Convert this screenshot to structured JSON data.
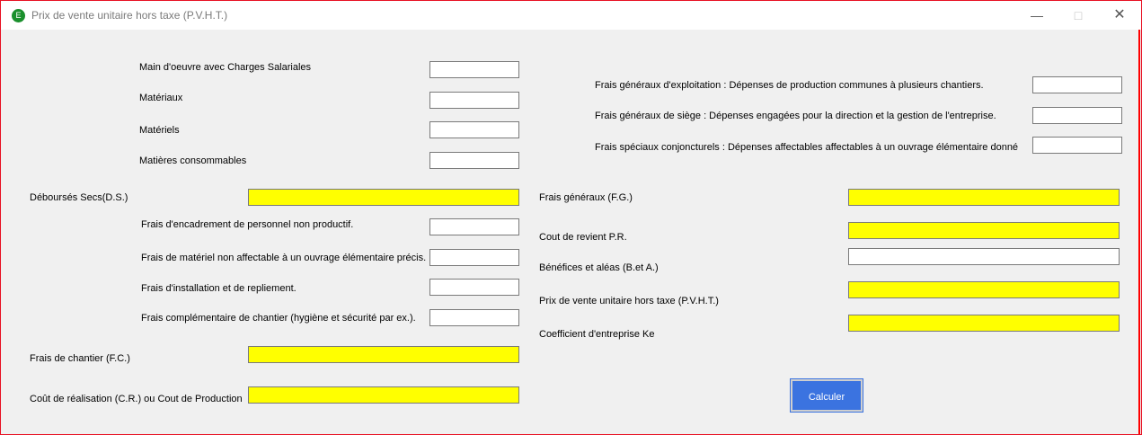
{
  "window": {
    "title": "Prix de vente unitaire hors taxe (P.V.H.T.)",
    "icon_letter": "E",
    "icon": "app-icon"
  },
  "left": {
    "main_oeuvre": "Main d'oeuvre avec Charges Salariales",
    "materiaux": "Matériaux",
    "materiels": "Matériels",
    "matieres": "Matières consommables",
    "debourses": "Déboursés Secs(D.S.)",
    "frais_encadrement": "Frais d'encadrement de personnel non productif.",
    "frais_materiel": "Frais de matériel non affectable à un ouvrage élémentaire précis.",
    "frais_installation": "Frais d'installation et de repliement.",
    "frais_complementaire": "Frais complémentaire de chantier (hygiène et  sécurité par ex.).",
    "frais_chantier": "Frais de chantier (F.C.)",
    "cout_realisation": "Coût de réalisation (C.R.) ou Cout de Production"
  },
  "right": {
    "fg_exploitation": "Frais généraux d'exploitation : Dépenses de production communes à plusieurs chantiers.",
    "fg_siege": "Frais généraux de siège : Dépenses engagées  pour la direction et la gestion de l'entreprise.",
    "fs_conjoncturels": "Frais spéciaux conjoncturels  : Dépenses affectables affectables à un ouvrage élémentaire donné",
    "frais_generaux": "Frais généraux (F.G.)",
    "cout_revient": "Cout de revient P.R.",
    "benefices": "Bénéfices et aléas (B.et A.)",
    "pvht": "Prix de vente unitaire  hors taxe (P.V.H.T.)",
    "coefficient": "Coefficient d'entreprise Ke"
  },
  "fields": {
    "main_oeuvre": "",
    "materiaux": "",
    "materiels": "",
    "matieres": "",
    "debourses": "",
    "frais_encadrement": "",
    "frais_materiel": "",
    "frais_installation": "",
    "frais_complementaire": "",
    "frais_chantier": "",
    "cout_realisation": "",
    "fg_exploitation": "",
    "fg_siege": "",
    "fs_conjoncturels": "",
    "frais_generaux": "",
    "cout_revient": "",
    "benefices": "",
    "pvht": "",
    "coefficient": ""
  },
  "buttons": {
    "calculer": "Calculer"
  },
  "colors": {
    "computed_field": "#ffff00",
    "button": "#3b73e0",
    "window_border": "#e81123"
  }
}
